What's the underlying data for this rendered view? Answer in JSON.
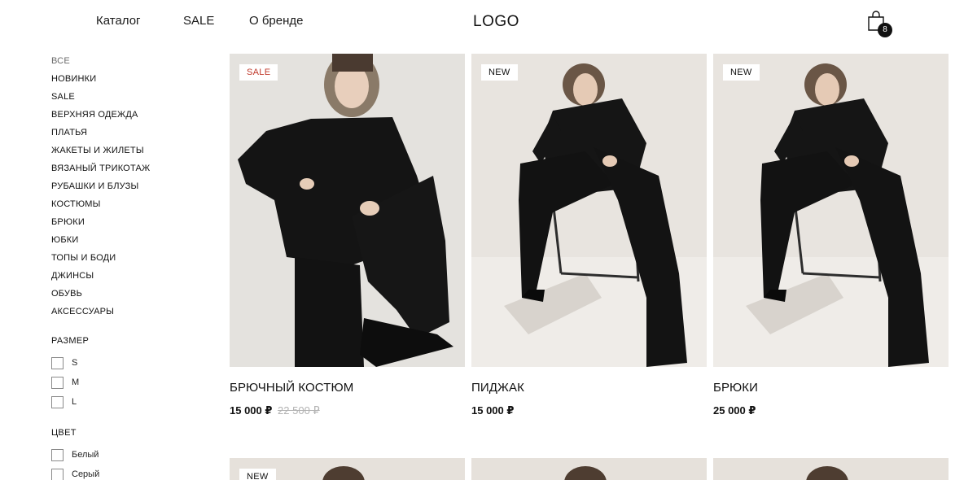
{
  "header": {
    "nav": [
      "Каталог",
      "SALE",
      "О бренде"
    ],
    "logo": "LOGO",
    "cart_icon": "shopping-bag-icon",
    "cart_count": "8"
  },
  "sidebar": {
    "categories": [
      "ВСЕ",
      "НОВИНКИ",
      "SALE",
      "ВЕРХНЯЯ ОДЕЖДА",
      "ПЛАТЬЯ",
      "ЖАКЕТЫ И ЖИЛЕТЫ",
      "ВЯЗАНЫЙ ТРИКОТАЖ",
      "РУБАШКИ И БЛУЗЫ",
      "КОСТЮМЫ",
      "БРЮКИ",
      "ЮБКИ",
      "ТОПЫ И БОДИ",
      "ДЖИНСЫ",
      "ОБУВЬ",
      "АКСЕССУАРЫ"
    ],
    "size_filter": {
      "title": "РАЗМЕР",
      "options": [
        "S",
        "M",
        "L"
      ]
    },
    "color_filter": {
      "title": "ЦВЕТ",
      "options": [
        "Белый",
        "Серый"
      ]
    }
  },
  "products": [
    {
      "badge": "SALE",
      "name": "БРЮЧНЫЙ КОСТЮМ",
      "price": "15 000 ₽",
      "old_price": "22 500 ₽"
    },
    {
      "badge": "NEW",
      "name": "ПИДЖАК",
      "price": "15 000 ₽",
      "old_price": ""
    },
    {
      "badge": "NEW",
      "name": "БРЮКИ",
      "price": "25 000 ₽",
      "old_price": ""
    }
  ],
  "products_row2": [
    {
      "badge": "NEW"
    },
    {
      "badge": ""
    },
    {
      "badge": ""
    }
  ],
  "colors": {
    "sale_badge": "#c0392b",
    "photo_background": "#e6e3df",
    "garment": "#121212"
  }
}
